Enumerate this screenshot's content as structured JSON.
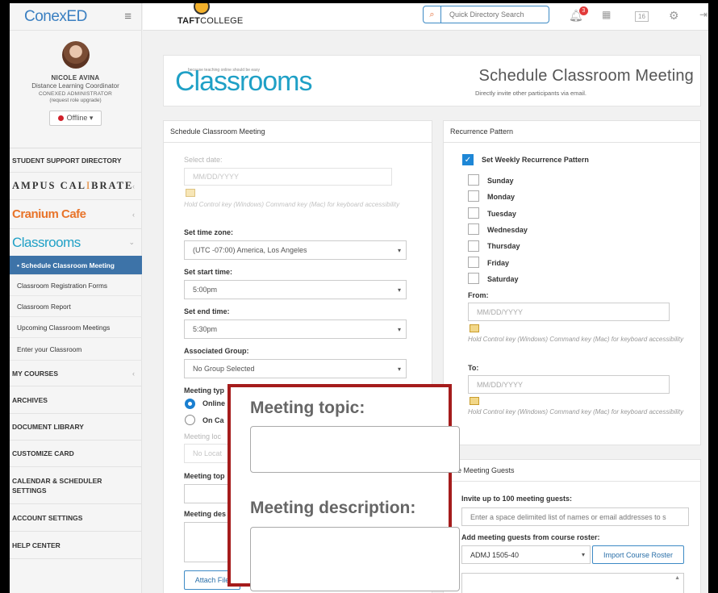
{
  "app": {
    "brand": "ConexED",
    "college": "TAFT",
    "college_suffix": "COLLEGE"
  },
  "profile": {
    "name": "NICOLE AVINA",
    "title": "Distance Learning Coordinator",
    "role": "CONEXED ADMINISTRATOR",
    "upgrade": "(request role upgrade)",
    "status": "Offline ▾"
  },
  "nav": {
    "student_support": "STUDENT SUPPORT DIRECTORY",
    "calibrate_a": "AMPUS CAL",
    "calibrate_b": "I",
    "calibrate_c": "BRATE",
    "cranium": "Cranium Cafe",
    "classrooms": "Classrooms",
    "sub": [
      "• Schedule Classroom Meeting",
      "Classroom Registration Forms",
      "Classroom Report",
      "Upcoming Classroom Meetings",
      "Enter your Classroom"
    ],
    "my_courses": "MY COURSES",
    "archives": "ARCHIVES",
    "document_library": "DOCUMENT LIBRARY",
    "customize_card": "CUSTOMIZE CARD",
    "calendar": "CALENDAR & SCHEDULER SETTINGS",
    "account": "ACCOUNT SETTINGS",
    "help": "HELP CENTER"
  },
  "topbar": {
    "search_placeholder": "Quick Directory Search",
    "notif_count": "3",
    "cal_day": "16"
  },
  "header": {
    "tagline": "because teaching online should be easy",
    "logo": "Classrooms",
    "title": "Schedule Classroom Meeting",
    "subtitle": "Directly invite other participants via email."
  },
  "schedule": {
    "head": "Schedule Classroom Meeting",
    "select_date": "Select date:",
    "date_ph": "MM/DD/YYYY",
    "hint": "Hold Control key (Windows) Command key (Mac) for keyboard accessibility",
    "tz_label": "Set time zone:",
    "tz_value": "(UTC -07:00) America, Los Angeles",
    "start_label": "Set start time:",
    "start_value": "5:00pm",
    "end_label": "Set end time:",
    "end_value": "5:30pm",
    "group_label": "Associated Group:",
    "group_value": "No Group Selected",
    "type_label": "Meeting typ",
    "type_online": "Online",
    "type_campus": "On Ca",
    "loc_label": "Meeting loc",
    "loc_value": "No Locat",
    "topic_label": "Meeting top",
    "desc_label": "Meeting des",
    "attach": "Attach File"
  },
  "recurrence": {
    "head": "Recurrence Pattern",
    "set_weekly": "Set Weekly Recurrence Pattern",
    "days": [
      "Sunday",
      "Monday",
      "Tuesday",
      "Wednesday",
      "Thursday",
      "Friday",
      "Saturday"
    ],
    "from": "From:",
    "to": "To:",
    "date_ph": "MM/DD/YYYY",
    "hint": "Hold Control key (Windows) Command key (Mac) for keyboard accessibility"
  },
  "guests": {
    "head": "vite Meeting Guests",
    "invite_label": "Invite up to 100 meeting guests:",
    "invite_ph": "Enter a space delimited list of names or email addresses to s",
    "roster_label": "Add meeting guests from course roster:",
    "roster_value": "ADMJ 1505-40",
    "import": "Import Course Roster"
  },
  "zoom": {
    "topic": "Meeting topic:",
    "description": "Meeting description:"
  }
}
